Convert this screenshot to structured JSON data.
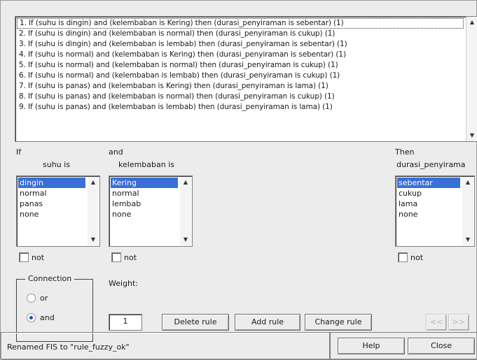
{
  "rules": [
    "1. If (suhu is dingin) and (kelembaban is Kering) then (durasi_penyiraman is sebentar) (1)",
    "2. If (suhu is dingin) and (kelembaban is normal) then (durasi_penyiraman is cukup) (1)",
    "3. If (suhu is dingin) and (kelembaban is lembab) then (durasi_penyiraman is sebentar) (1)",
    "4. If (suhu is normal) and (kelembaban is Kering) then (durasi_penyiraman is sebentar) (1)",
    "5. If (suhu is normal) and (kelembaban is normal) then (durasi_penyiraman is cukup) (1)",
    "6. If (suhu is normal) and (kelembaban is lembab) then (durasi_penyiraman is cukup) (1)",
    "7. If (suhu is panas) and (kelembaban is Kering) then (durasi_penyiraman is lama) (1)",
    "8. If (suhu is panas) and (kelembaban is normal) then (durasi_penyiraman is cukup) (1)",
    "9. If (suhu is panas) and (kelembaban is lembab) then (durasi_penyiraman is lama) (1)"
  ],
  "labels": {
    "if": "If",
    "and": "and",
    "then": "Then",
    "suhu": "suhu is",
    "kelembaban": "kelembaban is",
    "durasi": "durasi_penyirama",
    "not": "not",
    "connection": "Connection",
    "or": "or",
    "and_radio": "and",
    "weight": "Weight:"
  },
  "suhu_options": [
    "dingin",
    "normal",
    "panas",
    "none"
  ],
  "kelembaban_options": [
    "Kering",
    "normal",
    "lembab",
    "none"
  ],
  "durasi_options": [
    "sebentar",
    "cukup",
    "lama",
    "none"
  ],
  "connection_selected": "and",
  "weight_value": "1",
  "buttons": {
    "delete_rule": "Delete rule",
    "add_rule": "Add rule",
    "change_rule": "Change rule",
    "prev": "<<",
    "next": ">>",
    "help": "Help",
    "close": "Close"
  },
  "status": "Renamed FIS to \"rule_fuzzy_ok\"",
  "icons": {
    "scroll_up": "up-arrow-icon",
    "scroll_down": "down-arrow-icon"
  }
}
